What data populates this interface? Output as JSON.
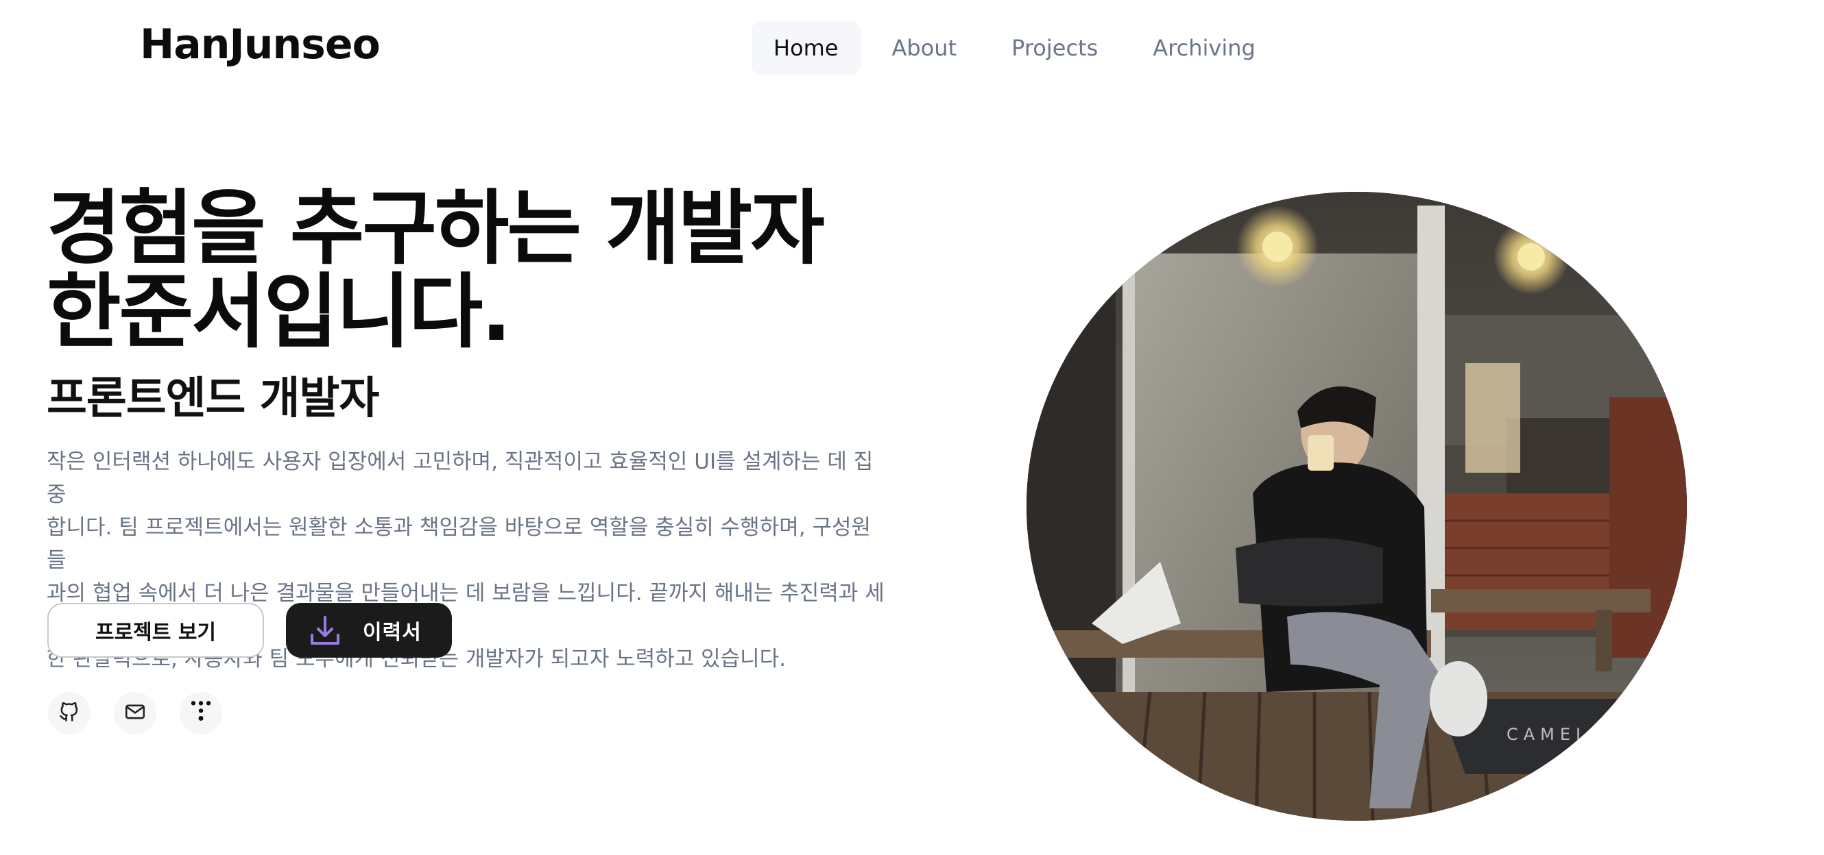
{
  "header": {
    "logo": "HanJunseo",
    "nav": [
      {
        "label": "Home",
        "active": true
      },
      {
        "label": "About",
        "active": false
      },
      {
        "label": "Projects",
        "active": false
      },
      {
        "label": "Archiving",
        "active": false
      }
    ]
  },
  "hero": {
    "headline_line1": "경험을 추구하는 개발자",
    "headline_line2": "한준서입니다.",
    "subtitle": "프론트엔드 개발자",
    "description_lines": [
      "작은 인터랙션 하나에도 사용자 입장에서 고민하며, 직관적이고 효율적인 UI를 설계하는 데 집중",
      "합니다. 팀 프로젝트에서는 원활한 소통과 책임감을 바탕으로 역할을 충실히 수행하며, 구성원들",
      "과의 협업 속에서 더 나은 결과물을 만들어내는 데 보람을 느낍니다. 끝까지 해내는 추진력과 세심",
      "한 관찰력으로, 사용자와 팀 모두에게 신뢰받는 개발자가 되고자 노력하고 있습니다."
    ],
    "buttons": {
      "projects_label": "프로젝트 보기",
      "resume_label": "이력서",
      "resume_icon": "download-icon"
    },
    "social": [
      {
        "icon": "github-icon"
      },
      {
        "icon": "mail-icon"
      },
      {
        "icon": "dots-icon"
      }
    ],
    "photo_sign_text": "CAMELA"
  },
  "colors": {
    "accent_purple": "#9b7de0",
    "dark_button": "#1b1b1c",
    "muted_text": "#6a7487",
    "nav_text": "#6b7588"
  }
}
